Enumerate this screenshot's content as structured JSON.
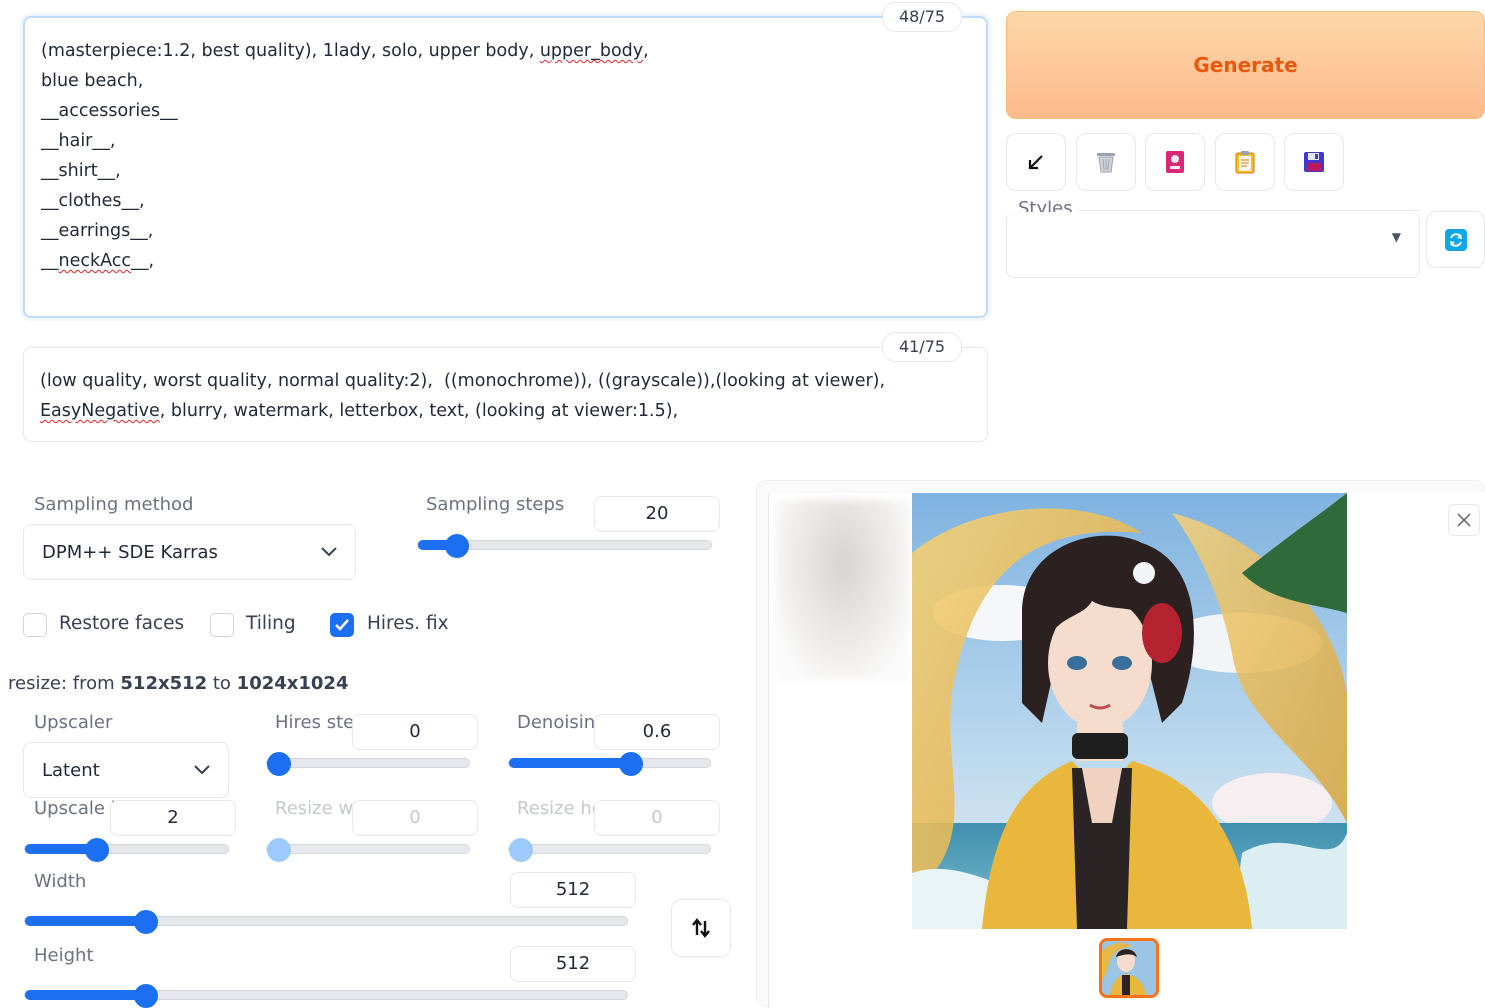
{
  "prompt": {
    "positive_lines": [
      "(masterpiece:1.2, best quality), 1lady, solo, upper body, ",
      "upper_body",
      ",",
      "blue beach,",
      "__accessories__",
      "__hair__,",
      "__shirt__,",
      "__clothes__,",
      "__earrings__,",
      "__",
      "neckAcc",
      "__,"
    ],
    "positive_token_count": "48/75",
    "negative_line1": "(low quality, worst quality, normal quality:2),  ((monochrome)), ((grayscale)),(looking at viewer),",
    "negative_line2_a": "EasyNegative",
    "negative_line2_b": ", blurry, watermark, letterbox, text, (looking at viewer:1.5),",
    "negative_token_count": "41/75"
  },
  "actions": {
    "generate_label": "Generate",
    "styles_label": "Styles"
  },
  "sampling": {
    "method_label": "Sampling method",
    "method_value": "DPM++ SDE Karras",
    "steps_label": "Sampling steps",
    "steps_value": "20",
    "steps_fraction": 0.13
  },
  "options": {
    "restore_faces": {
      "label": "Restore faces",
      "checked": false
    },
    "tiling": {
      "label": "Tiling",
      "checked": false
    },
    "hires_fix": {
      "label": "Hires. fix",
      "checked": true
    }
  },
  "hires": {
    "resize_prefix": "resize: from ",
    "resize_from": "512x512",
    "resize_mid": " to ",
    "resize_to": "1024x1024",
    "upscaler_label": "Upscaler",
    "upscaler_value": "Latent",
    "hires_steps_label": "Hires ste",
    "hires_steps_value": "0",
    "hires_steps_fraction": 0.0,
    "denoising_label": "Denoisin",
    "denoising_value": "0.6",
    "denoising_fraction": 0.6,
    "upscale_by_label": "Upscale b",
    "upscale_by_value": "2",
    "upscale_by_fraction": 0.35,
    "resize_width_label": "Resize wi",
    "resize_width_value": "0",
    "resize_height_label": "Resize he",
    "resize_height_value": "0"
  },
  "size": {
    "width_label": "Width",
    "width_value": "512",
    "width_fraction": 0.2,
    "height_label": "Height",
    "height_value": "512",
    "height_fraction": 0.2
  },
  "colors": {
    "accent": "#1d6ff2",
    "generate_text": "#ea580c"
  }
}
